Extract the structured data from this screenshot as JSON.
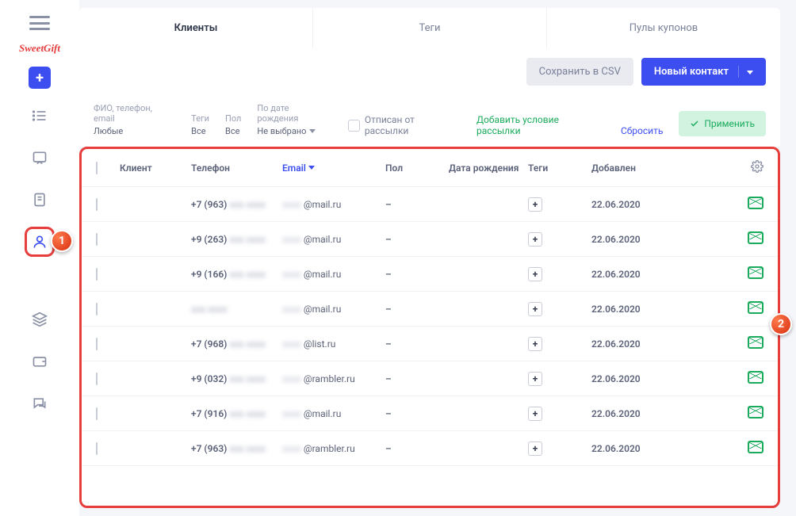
{
  "logo": "SweetGift",
  "tabs": {
    "clients": "Клиенты",
    "tags": "Теги",
    "coupons": "Пулы купонов"
  },
  "toolbar": {
    "csv": "Сохранить в CSV",
    "new_contact": "Новый контакт"
  },
  "filters": {
    "fio_lbl": "ФИО, телефон, email",
    "fio_val": "Любые",
    "tags_lbl": "Теги",
    "tags_val": "Все",
    "gender_lbl": "Пол",
    "gender_val": "Все",
    "birth_lbl": "По дате рождения",
    "birth_val": "Не выбрано",
    "unsub": "Отписан от рассылки",
    "add_cond": "Добавить условие рассылки",
    "reset": "Сбросить",
    "apply": "Применить"
  },
  "headers": {
    "client": "Клиент",
    "phone": "Телефон",
    "email": "Email",
    "gender": "Пол",
    "birth": "Дата рождения",
    "tags": "Теги",
    "added": "Добавлен"
  },
  "rows": [
    {
      "phone": "+7 (963)",
      "email": "@mail.ru",
      "gender": "–",
      "added": "22.06.2020"
    },
    {
      "phone": "+9 (263)",
      "email": "@mail.ru",
      "gender": "–",
      "added": "22.06.2020"
    },
    {
      "phone": "+9 (166)",
      "email": "@mail.ru",
      "gender": "–",
      "added": "22.06.2020"
    },
    {
      "phone": "",
      "email": "@mail.ru",
      "gender": "–",
      "added": "22.06.2020"
    },
    {
      "phone": "+7 (968)",
      "email": "@list.ru",
      "gender": "–",
      "added": "22.06.2020"
    },
    {
      "phone": "+9 (032)",
      "email": "@rambler.ru",
      "gender": "–",
      "added": "22.06.2020"
    },
    {
      "phone": "+7 (916)",
      "email": "@mail.ru",
      "gender": "–",
      "added": "22.06.2020"
    },
    {
      "phone": "+7 (963)",
      "email": "@rambler.ru",
      "gender": "–",
      "added": "22.06.2020"
    }
  ],
  "callouts": {
    "one": "1",
    "two": "2"
  }
}
